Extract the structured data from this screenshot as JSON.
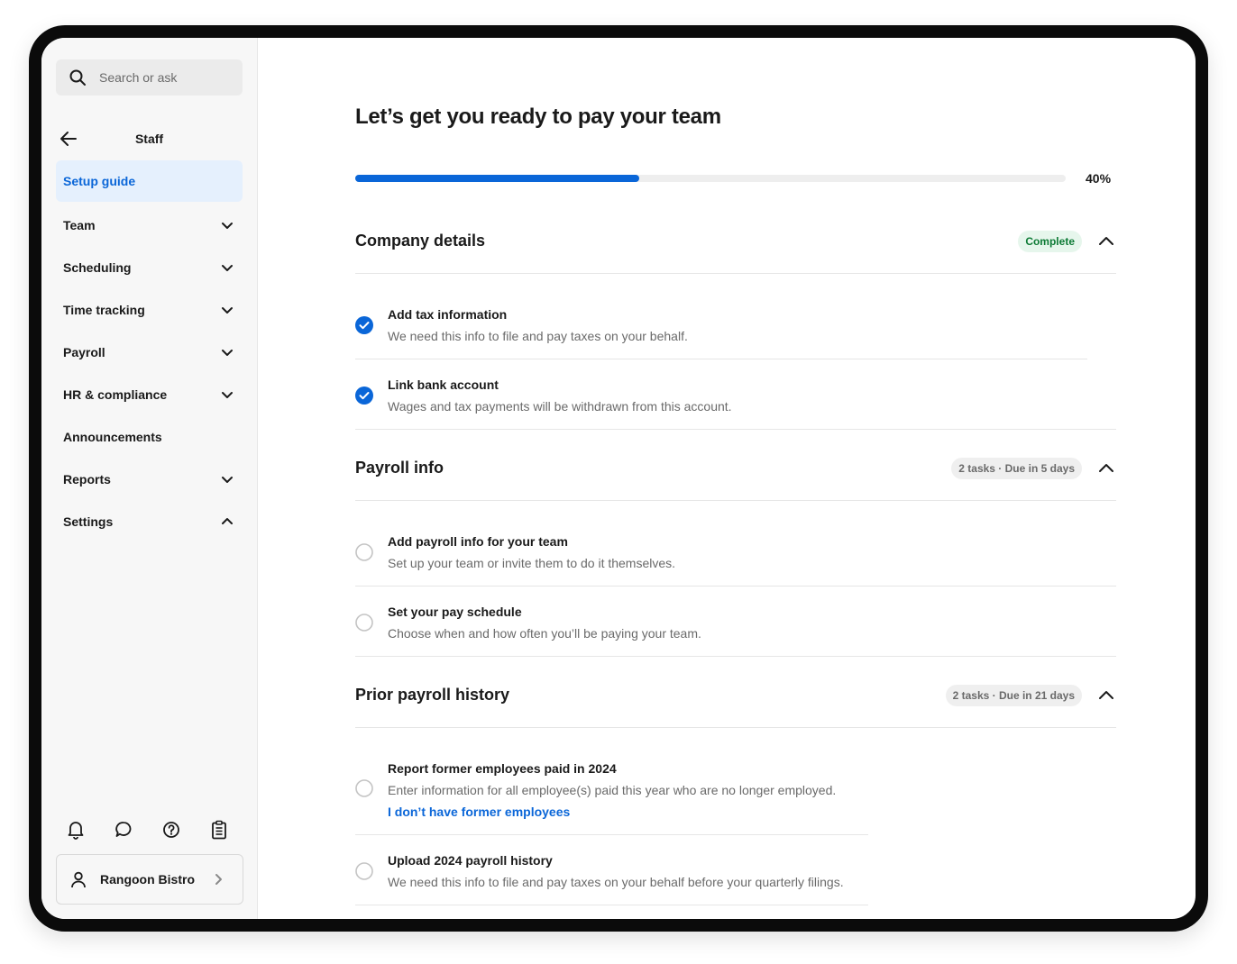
{
  "sidebar": {
    "search_placeholder": "Search or ask",
    "section_title": "Staff",
    "items": [
      {
        "label": "Setup guide",
        "active": true
      },
      {
        "label": "Team",
        "chevron": "down"
      },
      {
        "label": "Scheduling",
        "chevron": "down"
      },
      {
        "label": "Time tracking",
        "chevron": "down"
      },
      {
        "label": "Payroll",
        "chevron": "down"
      },
      {
        "label": "HR & compliance",
        "chevron": "down"
      },
      {
        "label": "Announcements"
      },
      {
        "label": "Reports",
        "chevron": "down"
      },
      {
        "label": "Settings",
        "chevron": "up"
      }
    ],
    "bottom_icons": [
      "bell-icon",
      "chat-icon",
      "help-icon",
      "clipboard-icon"
    ],
    "account": {
      "name": "Rangoon Bistro"
    }
  },
  "main": {
    "title": "Let’s get you ready to pay your team",
    "progress": {
      "percent": 40,
      "label": "40%"
    },
    "sections": [
      {
        "title": "Company details",
        "badge": "Complete",
        "badge_style": "green",
        "tasks": [
          {
            "title": "Add tax information",
            "description": "We need this info to file and pay taxes on your behalf.",
            "done": true
          },
          {
            "title": "Link bank account",
            "description": "Wages and tax payments will be withdrawn from this account.",
            "done": true
          }
        ]
      },
      {
        "title": "Payroll info",
        "badge": "2 tasks · Due in 5 days",
        "badge_style": "gray",
        "tasks": [
          {
            "title": "Add payroll info for your team",
            "description": "Set up your team or invite them to do it themselves.",
            "done": false
          },
          {
            "title": "Set your pay schedule",
            "description": "Choose when and how often you’ll be paying your team.",
            "done": false
          }
        ]
      },
      {
        "title": "Prior payroll history",
        "badge": "2 tasks · Due in 21 days",
        "badge_style": "gray",
        "tasks": [
          {
            "title": "Report former employees paid in 2024",
            "description": "Enter information for all employee(s) paid this year who are no longer employed.",
            "link": "I don’t have former employees",
            "done": false
          },
          {
            "title": "Upload 2024 payroll history",
            "description": "We need this info to file and pay taxes on your behalf before your quarterly filings.",
            "done": false
          }
        ]
      }
    ]
  },
  "colors": {
    "accent": "#0a66d8",
    "complete_badge_bg": "#e6f6ec",
    "complete_badge_text": "#0d7a35"
  }
}
